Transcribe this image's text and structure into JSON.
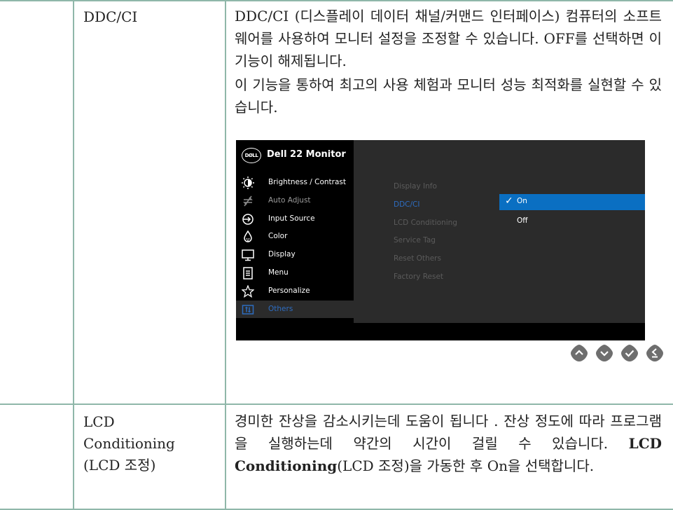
{
  "rows": [
    {
      "feature": "DDC/CI",
      "desc_p1": "DDC/CI (디스플레이 데이터 채널/커맨드 인터페이스) 컴퓨터의 소프트웨어를 사용하여 모니터 설정을 조정할 수 있습니다. OFF를 선택하면 이 기능이 해제됩니다.",
      "desc_p2": "이 기능을 통하여 최고의 사용 체험과 모니터 성능 최적화를 실현할 수 있습니다."
    },
    {
      "feature_line1": "LCD",
      "feature_line2": "Conditioning",
      "feature_line3": "(LCD 조정)",
      "desc_a": "경미한 잔상을 감소시키는데 도움이 됩니다 . 잔상 정도에 따라 프로그램을 실행하는데 약간의 시간이 걸릴 수 있습니다. ",
      "desc_bold": "LCD Conditioning",
      "desc_b": "(LCD 조정)을 가동한 후 On을 선택합니다."
    }
  ],
  "osd": {
    "logo": "DØLL",
    "title": "Dell 22 Monitor",
    "menu": [
      {
        "label": "Brightness / Contrast",
        "icon": "brightness-icon"
      },
      {
        "label": "Auto Adjust",
        "icon": "auto-adjust-icon"
      },
      {
        "label": "Input Source",
        "icon": "input-source-icon"
      },
      {
        "label": "Color",
        "icon": "color-icon"
      },
      {
        "label": "Display",
        "icon": "display-icon"
      },
      {
        "label": "Menu",
        "icon": "menu-icon"
      },
      {
        "label": "Personalize",
        "icon": "star-icon"
      },
      {
        "label": "Others",
        "icon": "others-icon"
      }
    ],
    "submenu": [
      "Display Info",
      "DDC/CI",
      "LCD Conditioning",
      "Service Tag",
      "Reset Others",
      "Factory Reset"
    ],
    "option_on": "On",
    "option_off": "Off",
    "colors": {
      "accent": "#0a6fc2",
      "selected_text": "#2d6cc0",
      "panel": "#2b2b2b",
      "sidebar": "#000000"
    }
  },
  "buttons": [
    "up-button-icon",
    "down-button-icon",
    "check-button-icon",
    "back-button-icon"
  ]
}
